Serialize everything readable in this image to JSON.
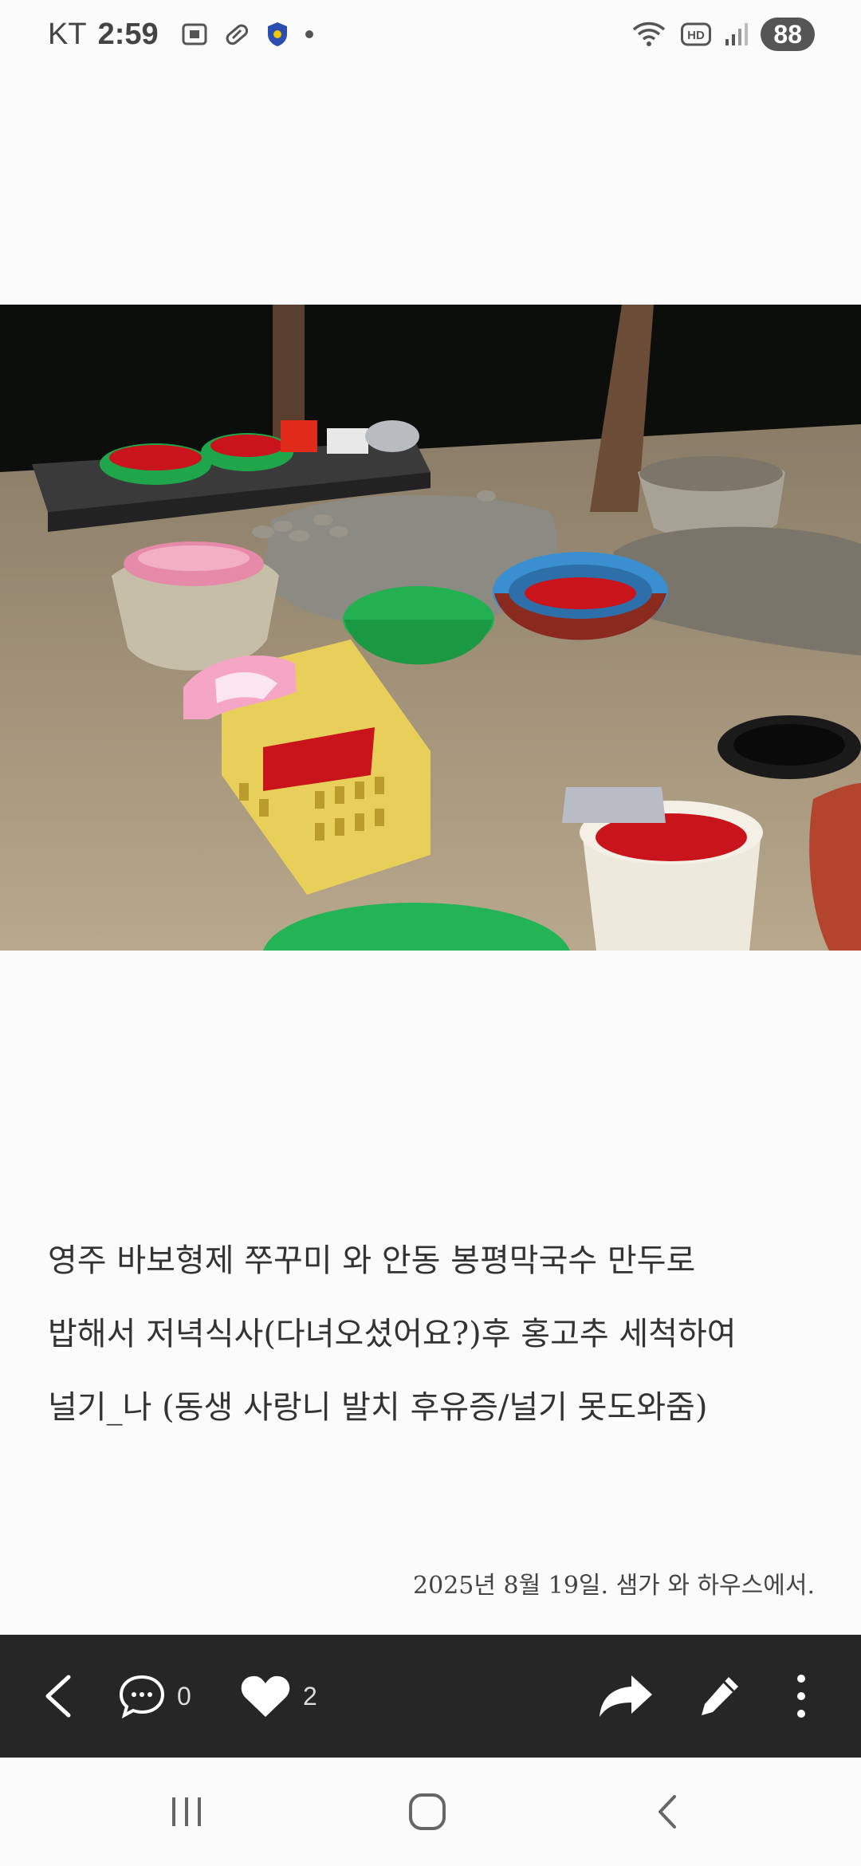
{
  "status_bar": {
    "carrier": "KT",
    "time": "2:59",
    "battery": "88",
    "icons": [
      "screenshot-icon",
      "pill-icon",
      "shield-icon",
      "dot-icon",
      "wifi-icon",
      "hd-icon",
      "signal-icon",
      "battery-icon"
    ]
  },
  "post": {
    "caption_lines": [
      "영주 바보형제 쭈꾸미 와 안동 봉평막국수 만두로",
      "밥해서 저녁식사(다녀오셨어요?)후 홍고추 세척하여",
      "널기_나 (동생 사랑니 발치 후유증/널기 못도와줌)"
    ],
    "date_line": "2025년 8월 19일. 샘가 와 하우스에서."
  },
  "action_bar": {
    "comment_count": "0",
    "like_count": "2",
    "icons": [
      "back-icon",
      "comment-icon",
      "heart-icon",
      "share-icon",
      "edit-icon",
      "more-icon"
    ]
  },
  "nav_bar": {
    "icons": [
      "recent-apps-icon",
      "home-icon",
      "back-icon"
    ]
  },
  "colors": {
    "action_bar_bg": "#262626",
    "page_bg": "#fbfbfb",
    "chili_red": "#c8141a",
    "basket_green": "#1fa64a",
    "basket_blue": "#3a8fd0",
    "crate_yellow": "#e8cf5a"
  }
}
